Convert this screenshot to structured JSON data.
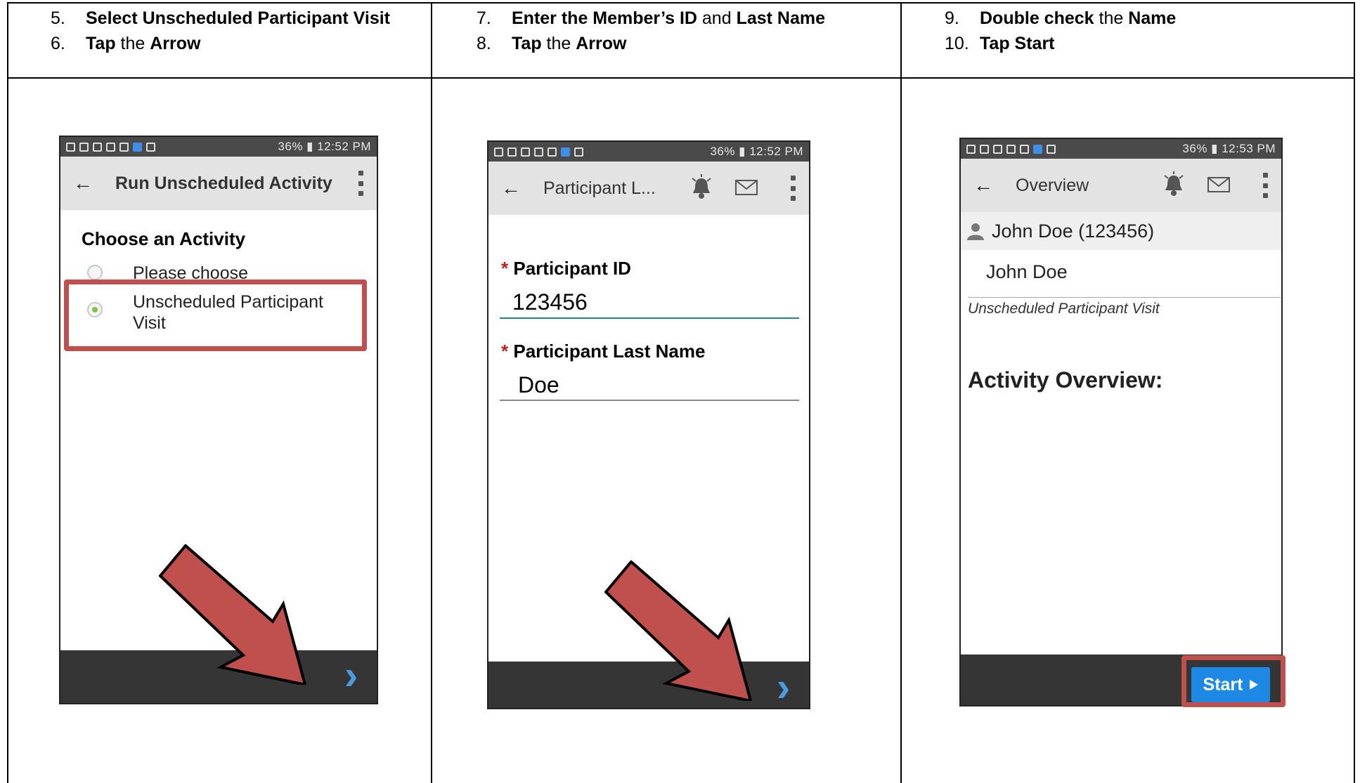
{
  "columns": [
    {
      "steps": [
        {
          "num": "5.",
          "parts": [
            {
              "b": "Select Unscheduled Participant Visit"
            }
          ]
        },
        {
          "num": "6.",
          "parts": [
            {
              "b": "Tap"
            },
            {
              "t": " the "
            },
            {
              "b": "Arrow"
            }
          ]
        }
      ]
    },
    {
      "steps": [
        {
          "num": "7.",
          "parts": [
            {
              "b": "Enter the Member’s ID"
            },
            {
              "t": " and "
            },
            {
              "b": "Last Name"
            }
          ]
        },
        {
          "num": "8.",
          "parts": [
            {
              "b": "Tap"
            },
            {
              "t": " the "
            },
            {
              "b": "Arrow"
            }
          ]
        }
      ]
    },
    {
      "steps": [
        {
          "num": "9.",
          "parts": [
            {
              "b": "Double check"
            },
            {
              "t": " the "
            },
            {
              "b": "Name"
            }
          ]
        },
        {
          "num": "10.",
          "parts": [
            {
              "b": "Tap Start"
            }
          ]
        }
      ]
    }
  ],
  "phone1": {
    "status": "36% ▮ 12:52 PM",
    "title": "Run Unscheduled Activity",
    "heading": "Choose an Activity",
    "options": [
      "Please choose",
      "Unscheduled Participant",
      "Visit"
    ],
    "next_icon": "chevron-right-icon"
  },
  "phone2": {
    "status": "36% ▮ 12:52 PM",
    "title": "Participant L...",
    "fields": [
      {
        "label": "Participant ID",
        "value": "123456"
      },
      {
        "label": "Participant Last Name",
        "value": "Doe"
      }
    ],
    "required_mark": "*",
    "next_icon": "chevron-right-icon"
  },
  "phone3": {
    "status": "36% ▮ 12:53 PM",
    "title": "Overview",
    "participant_header": "John Doe (123456)",
    "name": "John Doe",
    "activity": "Unscheduled Participant Visit",
    "overview_heading": "Activity Overview:",
    "start_label": "Start"
  },
  "colors": {
    "highlight": "#c0504d",
    "accent_blue": "#1e88e5",
    "chevron_blue": "#4a9be0",
    "field_active_line": "#1a8a7a"
  }
}
